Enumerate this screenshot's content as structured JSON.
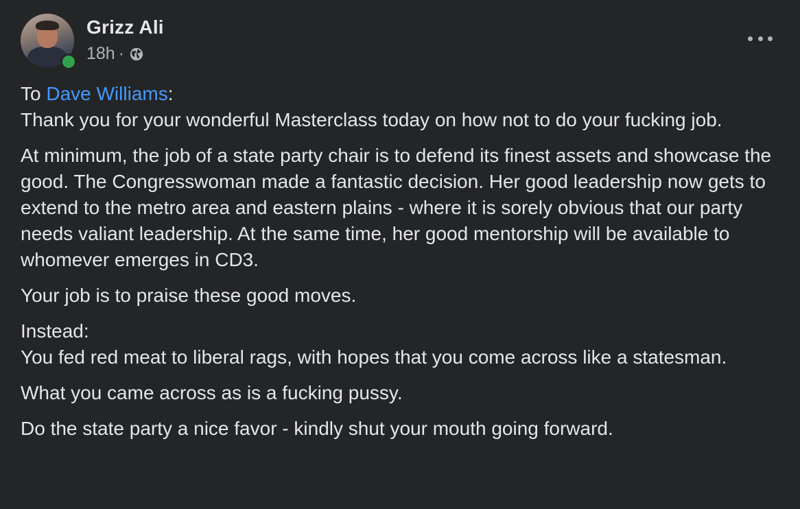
{
  "post": {
    "author": "Grizz Ali",
    "time": "18h",
    "separator": "·",
    "privacy_icon": "globe-icon",
    "more_icon": "more-options-icon",
    "online": true,
    "paragraphs": {
      "p1": {
        "prefix": "To ",
        "mention": "Dave Williams",
        "suffix": ":",
        "line2": "Thank you for your wonderful Masterclass today on how not to do your fucking job."
      },
      "p2": "At minimum, the job of a state party chair is to defend its finest assets and showcase the good. The Congresswoman made a fantastic decision. Her good leadership now gets to extend to the metro area and eastern plains - where it is sorely obvious that our party needs valiant leadership. At the same time, her good mentorship will be available to whomever emerges in CD3.",
      "p3": "Your job is to praise these good moves.",
      "p4": {
        "line1": "Instead:",
        "line2": "You fed red meat to liberal rags, with hopes that you come across like a statesman."
      },
      "p5": "What you came across as is a fucking pussy.",
      "p6": "Do the state party a nice favor - kindly shut your mouth going forward."
    }
  },
  "colors": {
    "background": "#242526",
    "text": "#e4e6eb",
    "secondary": "#b0b3b8",
    "mention": "#4599ff",
    "online": "#31a24c"
  }
}
